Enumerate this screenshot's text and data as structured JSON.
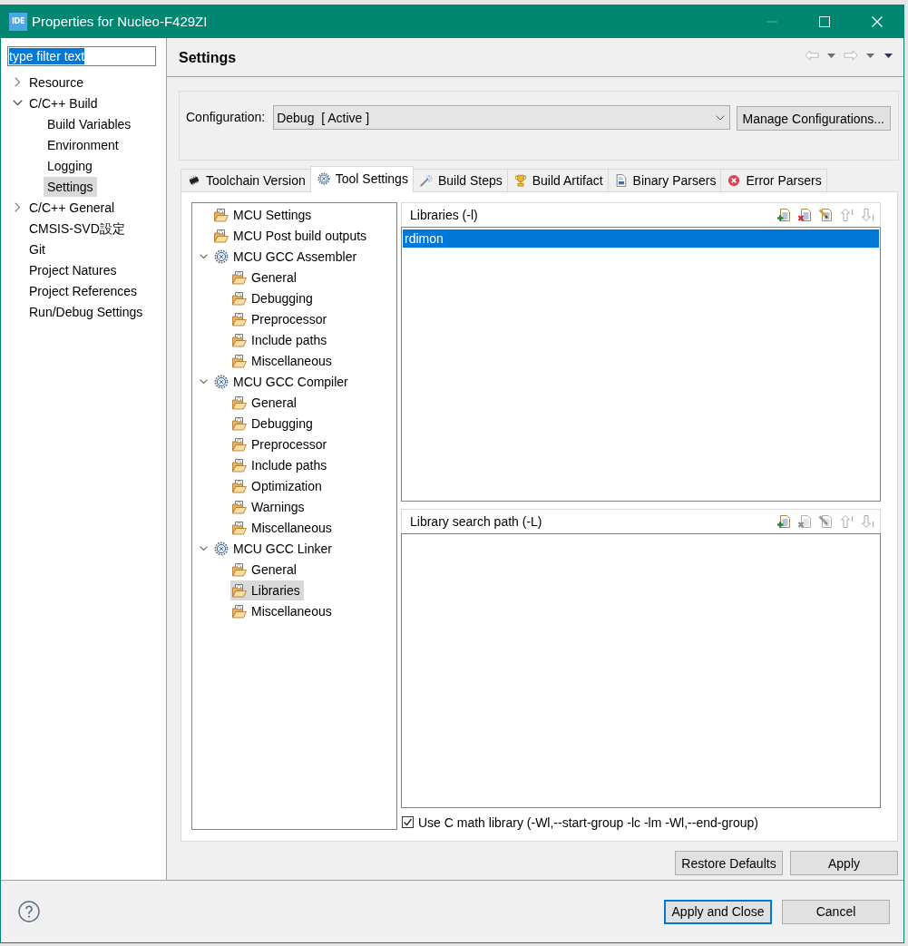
{
  "window": {
    "app_icon_text": "IDE",
    "title": "Properties for Nucleo-F429ZI",
    "controls": [
      {
        "kind": "minimize",
        "disabled": true
      },
      {
        "kind": "maximize",
        "disabled": false
      },
      {
        "kind": "close",
        "disabled": false
      }
    ]
  },
  "filter": {
    "value": "type filter text",
    "text_selected": true
  },
  "nav_tree": [
    {
      "label": "Resource",
      "kind": "group",
      "expanded": false,
      "selected": false
    },
    {
      "label": "C/C++ Build",
      "kind": "group",
      "expanded": true,
      "selected": false,
      "children": [
        {
          "label": "Build Variables",
          "selected": false
        },
        {
          "label": "Environment",
          "selected": false
        },
        {
          "label": "Logging",
          "selected": false
        },
        {
          "label": "Settings",
          "selected": true
        }
      ]
    },
    {
      "label": "C/C++ General",
      "kind": "group",
      "expanded": false,
      "selected": false
    },
    {
      "label": "CMSIS-SVD設定",
      "kind": "leaf",
      "selected": false
    },
    {
      "label": "Git",
      "kind": "leaf",
      "selected": false
    },
    {
      "label": "Project Natures",
      "kind": "leaf",
      "selected": false
    },
    {
      "label": "Project References",
      "kind": "leaf",
      "selected": false
    },
    {
      "label": "Run/Debug Settings",
      "kind": "leaf",
      "selected": false
    }
  ],
  "page": {
    "title": "Settings",
    "history": {
      "back_disabled": true,
      "forward_disabled": true
    }
  },
  "configuration": {
    "label": "Configuration:",
    "value": "Debug  [ Active ]",
    "manage_button": "Manage Configurations..."
  },
  "tabs": [
    {
      "label": "Toolchain Version",
      "selected": false
    },
    {
      "label": "Tool Settings",
      "selected": true
    },
    {
      "label": "Build Steps",
      "selected": false
    },
    {
      "label": "Build Artifact",
      "selected": false
    },
    {
      "label": "Binary Parsers",
      "selected": false
    },
    {
      "label": "Error Parsers",
      "selected": false
    }
  ],
  "tool_tree": [
    {
      "label": "MCU Settings",
      "kind": "option",
      "selected": false
    },
    {
      "label": "MCU Post build outputs",
      "kind": "option",
      "selected": false
    },
    {
      "label": "MCU GCC Assembler",
      "kind": "tool",
      "expanded": true,
      "selected": false,
      "children": [
        {
          "label": "General",
          "selected": false
        },
        {
          "label": "Debugging",
          "selected": false
        },
        {
          "label": "Preprocessor",
          "selected": false
        },
        {
          "label": "Include paths",
          "selected": false
        },
        {
          "label": "Miscellaneous",
          "selected": false
        }
      ]
    },
    {
      "label": "MCU GCC Compiler",
      "kind": "tool",
      "expanded": true,
      "selected": false,
      "children": [
        {
          "label": "General",
          "selected": false
        },
        {
          "label": "Debugging",
          "selected": false
        },
        {
          "label": "Preprocessor",
          "selected": false
        },
        {
          "label": "Include paths",
          "selected": false
        },
        {
          "label": "Optimization",
          "selected": false
        },
        {
          "label": "Warnings",
          "selected": false
        },
        {
          "label": "Miscellaneous",
          "selected": false
        }
      ]
    },
    {
      "label": "MCU GCC Linker",
      "kind": "tool",
      "expanded": true,
      "selected": false,
      "children": [
        {
          "label": "General",
          "selected": false
        },
        {
          "label": "Libraries",
          "selected": true
        },
        {
          "label": "Miscellaneous",
          "selected": false
        }
      ]
    }
  ],
  "lists": [
    {
      "title": "Libraries (-l)",
      "tools": [
        {
          "kind": "add",
          "disabled": false
        },
        {
          "kind": "delete",
          "disabled": false
        },
        {
          "kind": "edit",
          "disabled": false
        },
        {
          "kind": "up",
          "disabled": true
        },
        {
          "kind": "down",
          "disabled": true
        }
      ],
      "items": [
        {
          "text": "rdimon",
          "selected": true
        }
      ]
    },
    {
      "title": "Library search path (-L)",
      "tools": [
        {
          "kind": "add",
          "disabled": false
        },
        {
          "kind": "delete",
          "disabled": true
        },
        {
          "kind": "edit",
          "disabled": true
        },
        {
          "kind": "up",
          "disabled": true
        },
        {
          "kind": "down",
          "disabled": true
        }
      ]
    }
  ],
  "math_library": {
    "label": "Use C math library (-Wl,--start-group -lc -lm -Wl,--end-group)",
    "checked": true
  },
  "page_buttons": [
    "Restore Defaults",
    "Apply"
  ],
  "dialog_buttons": [
    {
      "label": "Apply and Close",
      "default": true
    },
    {
      "label": "Cancel",
      "default": false
    }
  ]
}
